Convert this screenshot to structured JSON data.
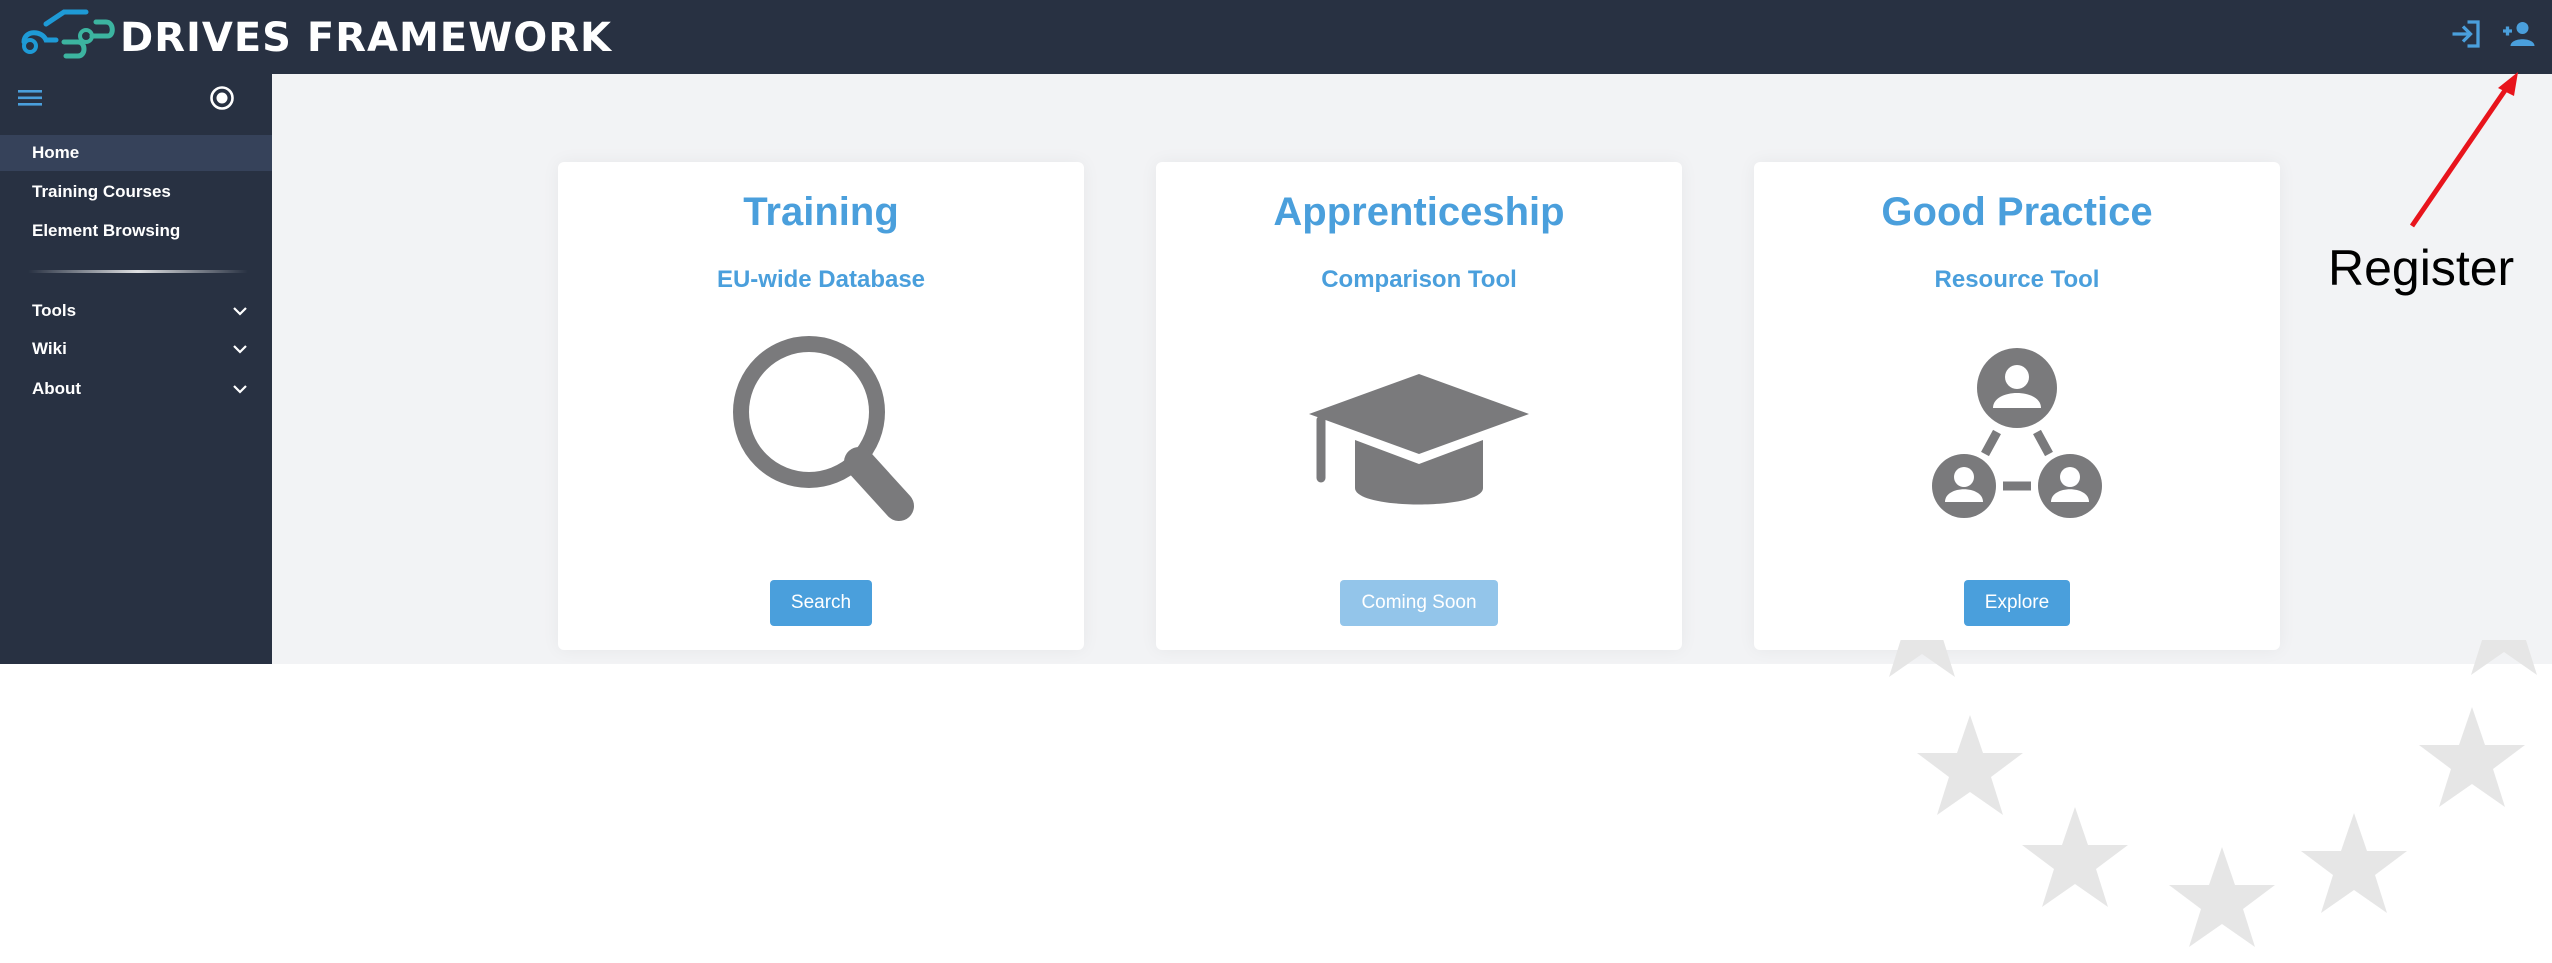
{
  "app": {
    "brand": "DRIVES FRAMEWORK",
    "colors": {
      "topbar": "#283142",
      "sidebar": "#283142",
      "sidebar_active": "#36425a",
      "content_bg": "#f2f3f5",
      "accent": "#4a9fdc",
      "accent_disabled": "#93c5ea",
      "icon_gray": "#7a7a7c",
      "logo_blue": "#1e9ad6",
      "logo_teal": "#3cb4a0"
    }
  },
  "header": {
    "icons": [
      "login-icon",
      "person-add-icon"
    ]
  },
  "sidebar": {
    "icons": [
      "hamburger-menu-icon",
      "radio-button-icon"
    ],
    "items": [
      {
        "label": "Home",
        "active": true
      },
      {
        "label": "Training Courses",
        "active": false
      },
      {
        "label": "Element Browsing",
        "active": false
      }
    ],
    "groups": [
      {
        "label": "Tools",
        "icon": "chevron-down-icon"
      },
      {
        "label": "Wiki",
        "icon": "chevron-down-icon"
      },
      {
        "label": "About",
        "icon": "chevron-down-icon"
      }
    ]
  },
  "cards": [
    {
      "title": "Training",
      "subtitle": "EU-wide Database",
      "icon": "magnifying-glass-icon",
      "button": "Search",
      "enabled": true
    },
    {
      "title": "Apprenticeship",
      "subtitle": "Comparison Tool",
      "icon": "graduation-cap-icon",
      "button": "Coming Soon",
      "enabled": false
    },
    {
      "title": "Good Practice",
      "subtitle": "Resource Tool",
      "icon": "people-network-icon",
      "button": "Explore",
      "enabled": true
    }
  ],
  "annotation": {
    "label": "Register",
    "color": "#e8141c"
  },
  "background": {
    "decoration": "eu-stars-icon",
    "star_color": "#e6e6e6"
  }
}
